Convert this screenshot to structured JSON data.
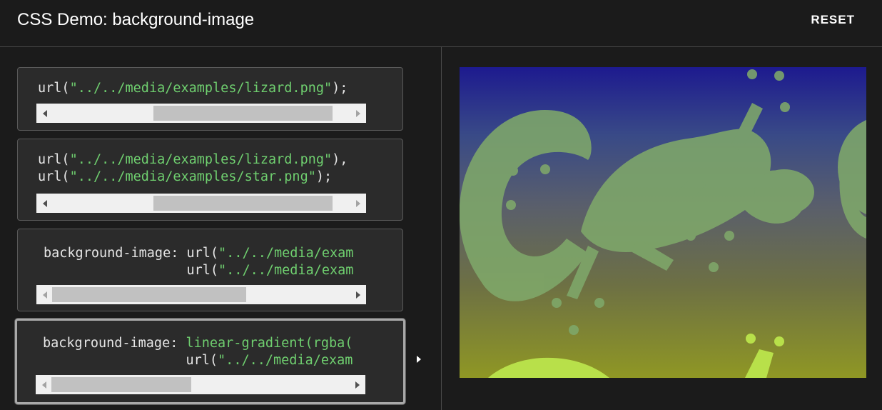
{
  "header": {
    "title": "CSS Demo: background-image",
    "reset_label": "RESET"
  },
  "choices": [
    {
      "lines": [
        [
          {
            "t": "url(",
            "c": "plain"
          },
          {
            "t": "\"../../media/examples/lizard.png\"",
            "c": "str"
          },
          {
            "t": ");",
            "c": "plain"
          }
        ]
      ],
      "scroll_position": 0.34,
      "scroll_visible_fraction": 0.6
    },
    {
      "lines": [
        [
          {
            "t": "url(",
            "c": "plain"
          },
          {
            "t": "\"../../media/examples/lizard.png\"",
            "c": "str"
          },
          {
            "t": "),",
            "c": "plain"
          }
        ],
        [
          {
            "t": "url(",
            "c": "plain"
          },
          {
            "t": "\"../../media/examples/star.png\"",
            "c": "str"
          },
          {
            "t": ");",
            "c": "plain"
          }
        ]
      ],
      "scroll_position": 0.34,
      "scroll_visible_fraction": 0.6
    },
    {
      "lines": [
        [
          {
            "t": "background-image: url(",
            "c": "plain"
          },
          {
            "t": "\"../../media/exam",
            "c": "str"
          }
        ],
        [
          {
            "t": "                  url(",
            "c": "plain"
          },
          {
            "t": "\"../../media/exam",
            "c": "str"
          }
        ]
      ],
      "scroll_position": 0.0,
      "scroll_visible_fraction": 0.65
    },
    {
      "lines": [
        [
          {
            "t": "background-image: ",
            "c": "plain"
          },
          {
            "t": "linear-gradient(rgba(",
            "c": "str"
          }
        ],
        [
          {
            "t": "                  url(",
            "c": "plain"
          },
          {
            "t": "\"../../media/exam",
            "c": "str"
          }
        ]
      ],
      "scroll_position": 0.0,
      "scroll_visible_fraction": 0.47,
      "selected": true
    }
  ],
  "output": {
    "gradient_colors": [
      "#1d1a8f",
      "#394a87",
      "#5a5f6b",
      "#6d7044",
      "#8f9724"
    ],
    "lizard_color": "#7fa86a",
    "lizard_bright_color": "#b8e04a"
  }
}
